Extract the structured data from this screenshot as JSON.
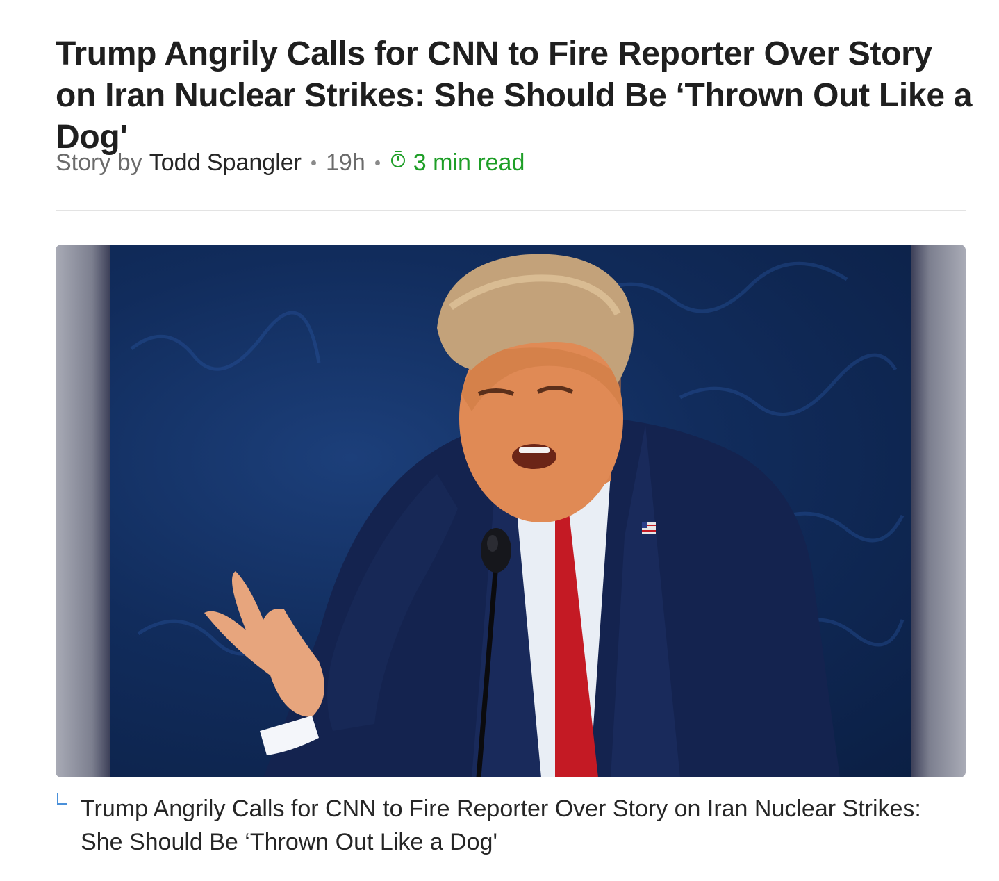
{
  "article": {
    "headline": "Trump Angrily Calls for CNN to Fire Reporter Over Story on Iran Nuclear Strikes: She Should Be ‘Thrown Out Like a Dog'",
    "byline_prefix": "Story by",
    "author": "Todd Spangler",
    "published_ago": "19h",
    "read_time": "3 min read",
    "caption": "Trump Angrily Calls for CNN to Fire Reporter Over Story on Iran Nuclear Strikes: She Should Be ‘Thrown Out Like a Dog'"
  },
  "colors": {
    "read_time_accent": "#1e9e27",
    "caption_marker": "#4a90d9",
    "photo_background": "#112c5c"
  },
  "icons": {
    "read_time": "stopwatch-icon",
    "caption": "caption-corner-icon"
  }
}
